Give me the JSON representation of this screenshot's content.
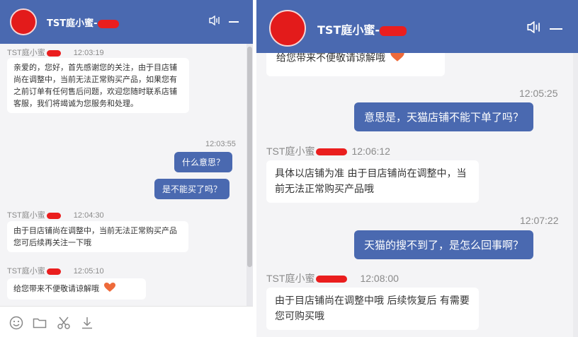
{
  "left": {
    "header": {
      "title": "TST庭小蜜-"
    },
    "messages": [
      {
        "sender": "TST庭小蜜",
        "time": "12:03:19",
        "text": "亲爱的，您好，首先感谢您的关注，由于目店铺尚在调整中，当前无法正常购买产品，如果您有之前订单有任何售后问题，欢迎您随时联系店铺客服，我们将竭诚为您服务和处理。"
      },
      {
        "stamp": "12:03:55",
        "bubbles": [
          "什么意思？",
          "是不能买了吗？"
        ]
      },
      {
        "sender": "TST庭小蜜",
        "time": "12:04:30",
        "text": "由于目店铺尚在调整中，当前无法正常购买产品 您可后续再关注一下哦"
      },
      {
        "sender": "TST庭小蜜",
        "time": "12:05:10",
        "text": "给您带来不便敬请谅解哦"
      }
    ],
    "toolbar": [
      "emoji-icon",
      "folder-icon",
      "scissors-icon",
      "download-icon"
    ]
  },
  "right": {
    "header": {
      "title": "TST庭小蜜-"
    },
    "partial_text": "给您带来不便敬请谅解哦",
    "messages": [
      {
        "stamp": "12:05:25",
        "bubble": "意思是，天猫店铺不能下单了吗？"
      },
      {
        "sender": "TST庭小蜜",
        "time": "12:06:12",
        "text": "具体以店铺为准 由于目店铺尚在调整中，当前无法正常购买产品哦"
      },
      {
        "stamp": "12:07:22",
        "bubble": "天猫的搜不到了，是怎么回事啊？"
      },
      {
        "sender": "TST庭小蜜",
        "time": "12:08:00",
        "text": "由于目店铺尚在调整中哦 后续恢复后 有需要您可购买哦"
      }
    ]
  },
  "colors": {
    "header": "#4a69b0",
    "outgoing_bubble": "#4a69b0",
    "redaction": "#e31b1b",
    "background": "#f4f4f6"
  }
}
